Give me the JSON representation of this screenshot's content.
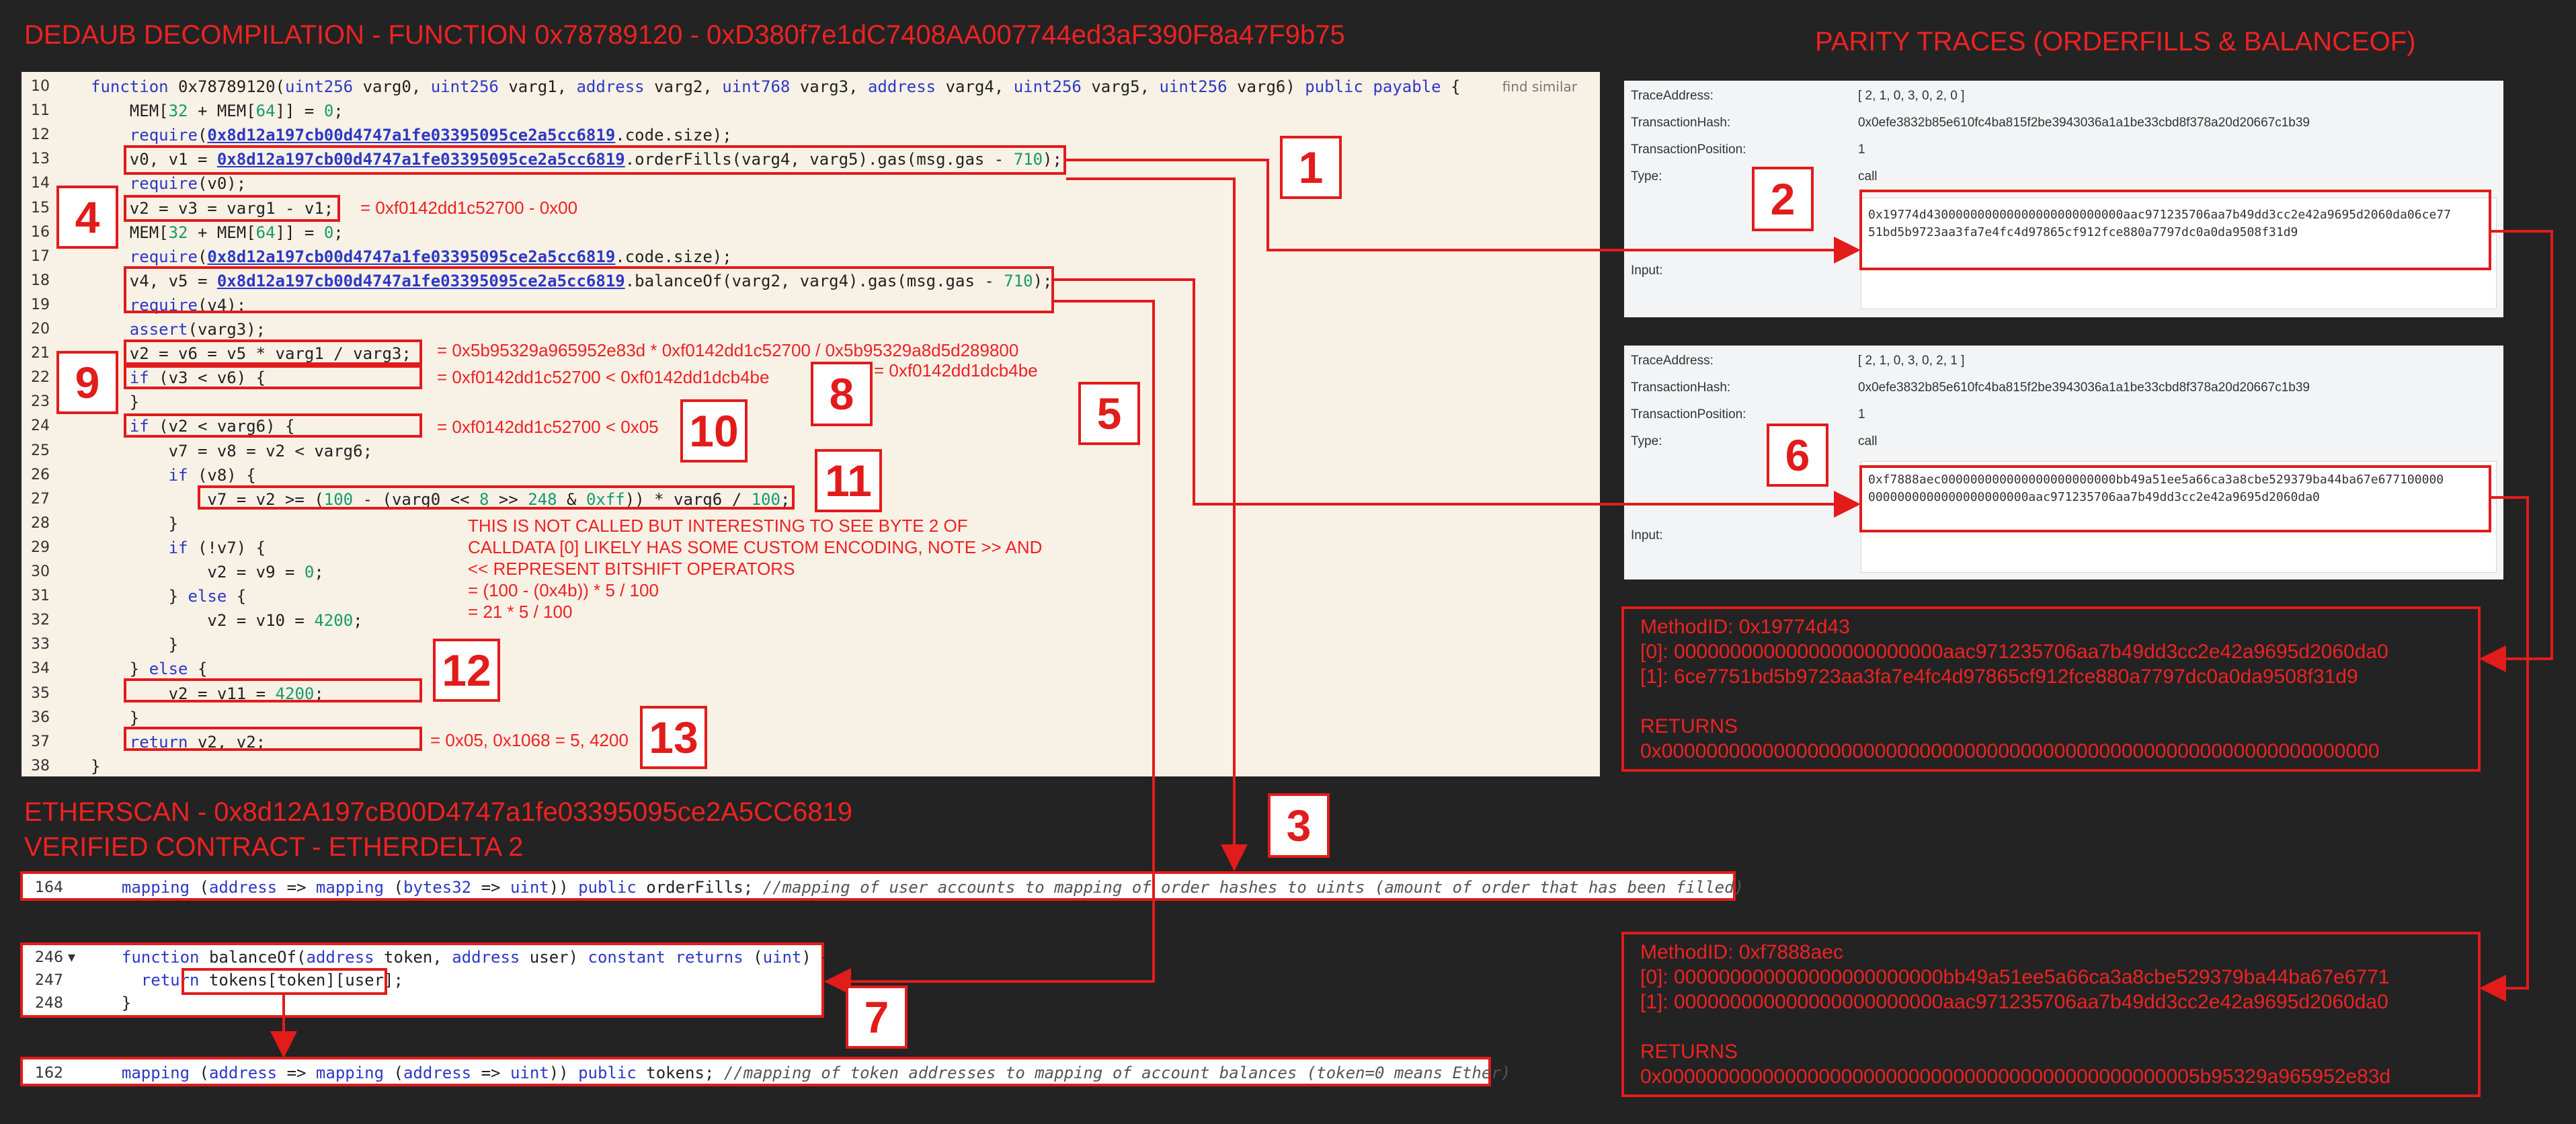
{
  "titles": {
    "dedaub": "DEDAUB DECOMPILATION - FUNCTION 0x78789120 - 0xD380f7e1dC7408AA007744ed3aF390F8a47F9b75",
    "parity": "PARITY TRACES (ORDERFILLS & BALANCEOF)",
    "etherscan": "ETHERSCAN - 0x8d12A197cB00D4747a1fe03395095ce2A5CC6819",
    "verified": "VERIFIED CONTRACT - ETHERDELTA 2"
  },
  "code": {
    "find_similar": "find similar",
    "lines": [
      {
        "n": "10",
        "t": "function 0x78789120(uint256 varg0, uint256 varg1, address varg2, uint768 varg3, address varg4, uint256 varg5, uint256 varg6) public payable {"
      },
      {
        "n": "11",
        "t": "    MEM[32 + MEM[64]] = 0;"
      },
      {
        "n": "12",
        "t": "    require(0x8d12a197cb00d4747a1fe03395095ce2a5cc6819.code.size);"
      },
      {
        "n": "13",
        "t": "    v0, v1 = 0x8d12a197cb00d4747a1fe03395095ce2a5cc6819.orderFills(varg4, varg5).gas(msg.gas - 710);"
      },
      {
        "n": "14",
        "t": "    require(v0);"
      },
      {
        "n": "15",
        "t": "    v2 = v3 = varg1 - v1;"
      },
      {
        "n": "16",
        "t": "    MEM[32 + MEM[64]] = 0;"
      },
      {
        "n": "17",
        "t": "    require(0x8d12a197cb00d4747a1fe03395095ce2a5cc6819.code.size);"
      },
      {
        "n": "18",
        "t": "    v4, v5 = 0x8d12a197cb00d4747a1fe03395095ce2a5cc6819.balanceOf(varg2, varg4).gas(msg.gas - 710);"
      },
      {
        "n": "19",
        "t": "    require(v4);"
      },
      {
        "n": "20",
        "t": "    assert(varg3);"
      },
      {
        "n": "21",
        "t": "    v2 = v6 = v5 * varg1 / varg3;"
      },
      {
        "n": "22",
        "t": "    if (v3 < v6) {"
      },
      {
        "n": "23",
        "t": "    }"
      },
      {
        "n": "24",
        "t": "    if (v2 < varg6) {"
      },
      {
        "n": "25",
        "t": "        v7 = v8 = v2 < varg6;"
      },
      {
        "n": "26",
        "t": "        if (v8) {"
      },
      {
        "n": "27",
        "t": "            v7 = v2 >= (100 - (varg0 << 8 >> 248 & 0xff)) * varg6 / 100;"
      },
      {
        "n": "28",
        "t": "        }"
      },
      {
        "n": "29",
        "t": "        if (!v7) {"
      },
      {
        "n": "30",
        "t": "            v2 = v9 = 0;"
      },
      {
        "n": "31",
        "t": "        } else {"
      },
      {
        "n": "32",
        "t": "            v2 = v10 = 4200;"
      },
      {
        "n": "33",
        "t": "        }"
      },
      {
        "n": "34",
        "t": "    } else {"
      },
      {
        "n": "35",
        "t": "        v2 = v11 = 4200;"
      },
      {
        "n": "36",
        "t": "    }"
      },
      {
        "n": "37",
        "t": "    return v2, v2;"
      },
      {
        "n": "38",
        "t": "}"
      }
    ]
  },
  "annotations": {
    "a15": "= 0xf0142dd1c52700 - 0x00",
    "a21": "= 0x5b95329a965952e83d * 0xf0142dd1c52700 / 0x5b95329a8d5d289800",
    "a22": "= 0xf0142dd1c52700 < 0xf0142dd1dcb4be",
    "a8": "= 0xf0142dd1dcb4be",
    "a24": "= 0xf0142dd1c52700 < 0x05",
    "note_lines": [
      "THIS IS NOT CALLED BUT INTERESTING TO SEE BYTE 2 OF",
      "CALLDATA [0]  LIKELY HAS SOME CUSTOM ENCODING, NOTE >> AND",
      "<< REPRESENT BITSHIFT OPERATORS",
      "= (100 - (0x4b)) * 5 / 100",
      "= 21 * 5 / 100"
    ],
    "a37": "= 0x05, 0x1068 = 5, 4200"
  },
  "numbers": [
    "1",
    "2",
    "3",
    "4",
    "5",
    "6",
    "7",
    "8",
    "9",
    "10",
    "11",
    "12",
    "13"
  ],
  "traces": [
    {
      "labels": {
        "trace_address": "TraceAddress:",
        "tx_hash": "TransactionHash:",
        "tx_pos": "TransactionPosition:",
        "type": "Type:",
        "input": "Input:"
      },
      "trace_address": "[ 2, 1, 0, 3, 0, 2, 0 ]",
      "tx_hash": "0x0efe3832b85e610fc4ba815f2be3943036a1a1be33cbd8f378a20d20667c1b39",
      "tx_pos": "1",
      "type": "call",
      "input_lines": [
        "0x19774d430000000000000000000000000aac971235706aa7b49dd3cc2e42a9695d2060da06ce77",
        "51bd5b9723aa3fa7e4fc4d97865cf912fce880a7797dc0a0da9508f31d9"
      ]
    },
    {
      "labels": {
        "trace_address": "TraceAddress:",
        "tx_hash": "TransactionHash:",
        "tx_pos": "TransactionPosition:",
        "type": "Type:",
        "input": "Input:"
      },
      "trace_address": "[ 2, 1, 0, 3, 0, 2, 1 ]",
      "tx_hash": "0x0efe3832b85e610fc4ba815f2be3943036a1a1be33cbd8f378a20d20667c1b39",
      "tx_pos": "1",
      "type": "call",
      "input_lines": [
        "0xf7888aec000000000000000000000000bb49a51ee5a66ca3a8cbe529379ba44ba67e677100000",
        "0000000000000000000000aac971235706aa7b49dd3cc2e42a9695d2060da0"
      ]
    }
  ],
  "decoded": [
    {
      "lines": [
        "MethodID: 0x19774d43",
        "[0]: 000000000000000000000000aac971235706aa7b49dd3cc2e42a9695d2060da0",
        "[1]: 6ce7751bd5b9723aa3fa7e4fc4d97865cf912fce880a7797dc0a0da9508f31d9",
        "",
        "RETURNS",
        "0x0000000000000000000000000000000000000000000000000000000000000000"
      ]
    },
    {
      "lines": [
        "MethodID: 0xf7888aec",
        "[0]: 000000000000000000000000bb49a51ee5a66ca3a8cbe529379ba44ba67e6771",
        "[1]: 000000000000000000000000aac971235706aa7b49dd3cc2e42a9695d2060da0",
        "",
        "RETURNS",
        "0x000000000000000000000000000000000000000000000005b95329a965952e83d"
      ]
    }
  ],
  "etherscan": {
    "orderfills": {
      "n": "164",
      "t": "  mapping (address => mapping (bytes32 => uint)) public orderFills; //mapping of user accounts to mapping of order hashes to uints (amount of order that has been filled)"
    },
    "balanceof": [
      {
        "n": "246 ▾",
        "t": "  function balanceOf(address token, address user) constant returns (uint) {"
      },
      {
        "n": "247",
        "t": "    return tokens[token][user];"
      },
      {
        "n": "248",
        "t": "  }"
      }
    ],
    "tokens": {
      "n": "162",
      "t": "  mapping (address => mapping (address => uint)) public tokens; //mapping of token addresses to mapping of account balances (token=0 means Ether)"
    }
  }
}
